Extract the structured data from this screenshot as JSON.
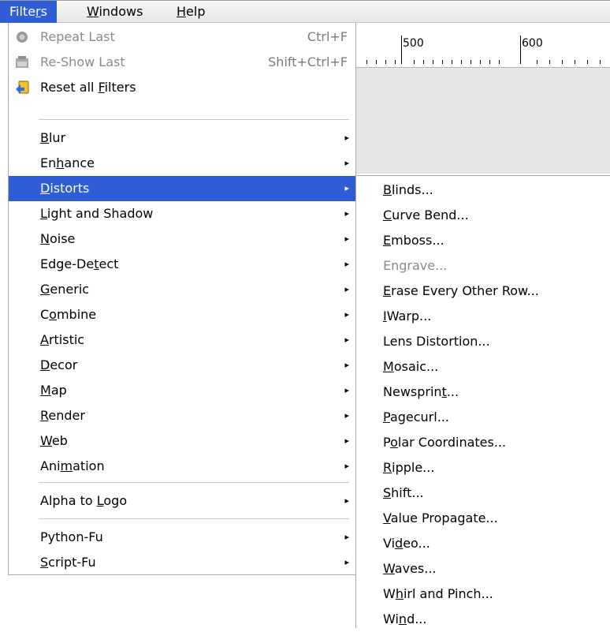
{
  "menubar": {
    "items": [
      {
        "pre": "Filte",
        "u": "r",
        "post": "s"
      },
      {
        "pre": "",
        "u": "W",
        "post": "indows"
      },
      {
        "pre": "",
        "u": "H",
        "post": "elp"
      }
    ]
  },
  "ruler": {
    "label_500": "500",
    "label_600": "600"
  },
  "filters_menu": {
    "top_items": [
      {
        "label": "Repeat Last",
        "accel": "Ctrl+F",
        "icon": "repeat-icon"
      },
      {
        "label": "Re-Show Last",
        "accel": "Shift+Ctrl+F",
        "icon": "reshow-icon"
      },
      {
        "pre": "Reset all ",
        "u": "F",
        "post": "ilters",
        "icon": "reset-icon"
      }
    ],
    "categories": [
      {
        "pre": "",
        "u": "B",
        "post": "lur"
      },
      {
        "pre": "En",
        "u": "h",
        "post": "ance"
      },
      {
        "pre": "",
        "u": "D",
        "post": "istorts"
      },
      {
        "pre": "",
        "u": "L",
        "post": "ight and Shadow"
      },
      {
        "pre": "",
        "u": "N",
        "post": "oise"
      },
      {
        "pre": "Edge-De",
        "u": "t",
        "post": "ect"
      },
      {
        "pre": "",
        "u": "G",
        "post": "eneric"
      },
      {
        "pre": "C",
        "u": "o",
        "post": "mbine"
      },
      {
        "pre": "",
        "u": "A",
        "post": "rtistic"
      },
      {
        "pre": "",
        "u": "D",
        "post": "ecor"
      },
      {
        "pre": "",
        "u": "M",
        "post": "ap"
      },
      {
        "pre": "",
        "u": "R",
        "post": "ender"
      },
      {
        "pre": "",
        "u": "W",
        "post": "eb"
      },
      {
        "pre": "Ani",
        "u": "m",
        "post": "ation"
      }
    ],
    "alpha": {
      "pre": "Alpha to ",
      "u": "L",
      "post": "ogo"
    },
    "python": {
      "pre": "Python-Fu",
      "u": "",
      "post": ""
    },
    "script": {
      "pre": "",
      "u": "S",
      "post": "cript-Fu"
    }
  },
  "distorts_submenu": {
    "items": [
      {
        "pre": "",
        "u": "B",
        "post": "linds..."
      },
      {
        "pre": "",
        "u": "C",
        "post": "urve Bend..."
      },
      {
        "pre": "",
        "u": "E",
        "post": "mboss..."
      },
      {
        "pre": "En",
        "u": "g",
        "post": "rave..."
      },
      {
        "pre": "",
        "u": "E",
        "post": "rase Every Other Row..."
      },
      {
        "pre": "",
        "u": "I",
        "post": "Warp..."
      },
      {
        "pre": "Lens Distortion...",
        "u": "",
        "post": ""
      },
      {
        "pre": "",
        "u": "M",
        "post": "osaic..."
      },
      {
        "pre": "Newsprin",
        "u": "t",
        "post": "..."
      },
      {
        "pre": "",
        "u": "P",
        "post": "agecurl..."
      },
      {
        "pre": "P",
        "u": "o",
        "post": "lar Coordinates..."
      },
      {
        "pre": "",
        "u": "R",
        "post": "ipple..."
      },
      {
        "pre": "",
        "u": "S",
        "post": "hift..."
      },
      {
        "pre": "",
        "u": "V",
        "post": "alue Propagate..."
      },
      {
        "pre": "Vi",
        "u": "d",
        "post": "eo..."
      },
      {
        "pre": "",
        "u": "W",
        "post": "aves..."
      },
      {
        "pre": "W",
        "u": "h",
        "post": "irl and Pinch..."
      },
      {
        "pre": "Wi",
        "u": "n",
        "post": "d..."
      }
    ]
  },
  "colors": {
    "highlight": "#2f5dd6",
    "disabled": "#8a8a8a"
  },
  "submenu_arrow": "▸"
}
